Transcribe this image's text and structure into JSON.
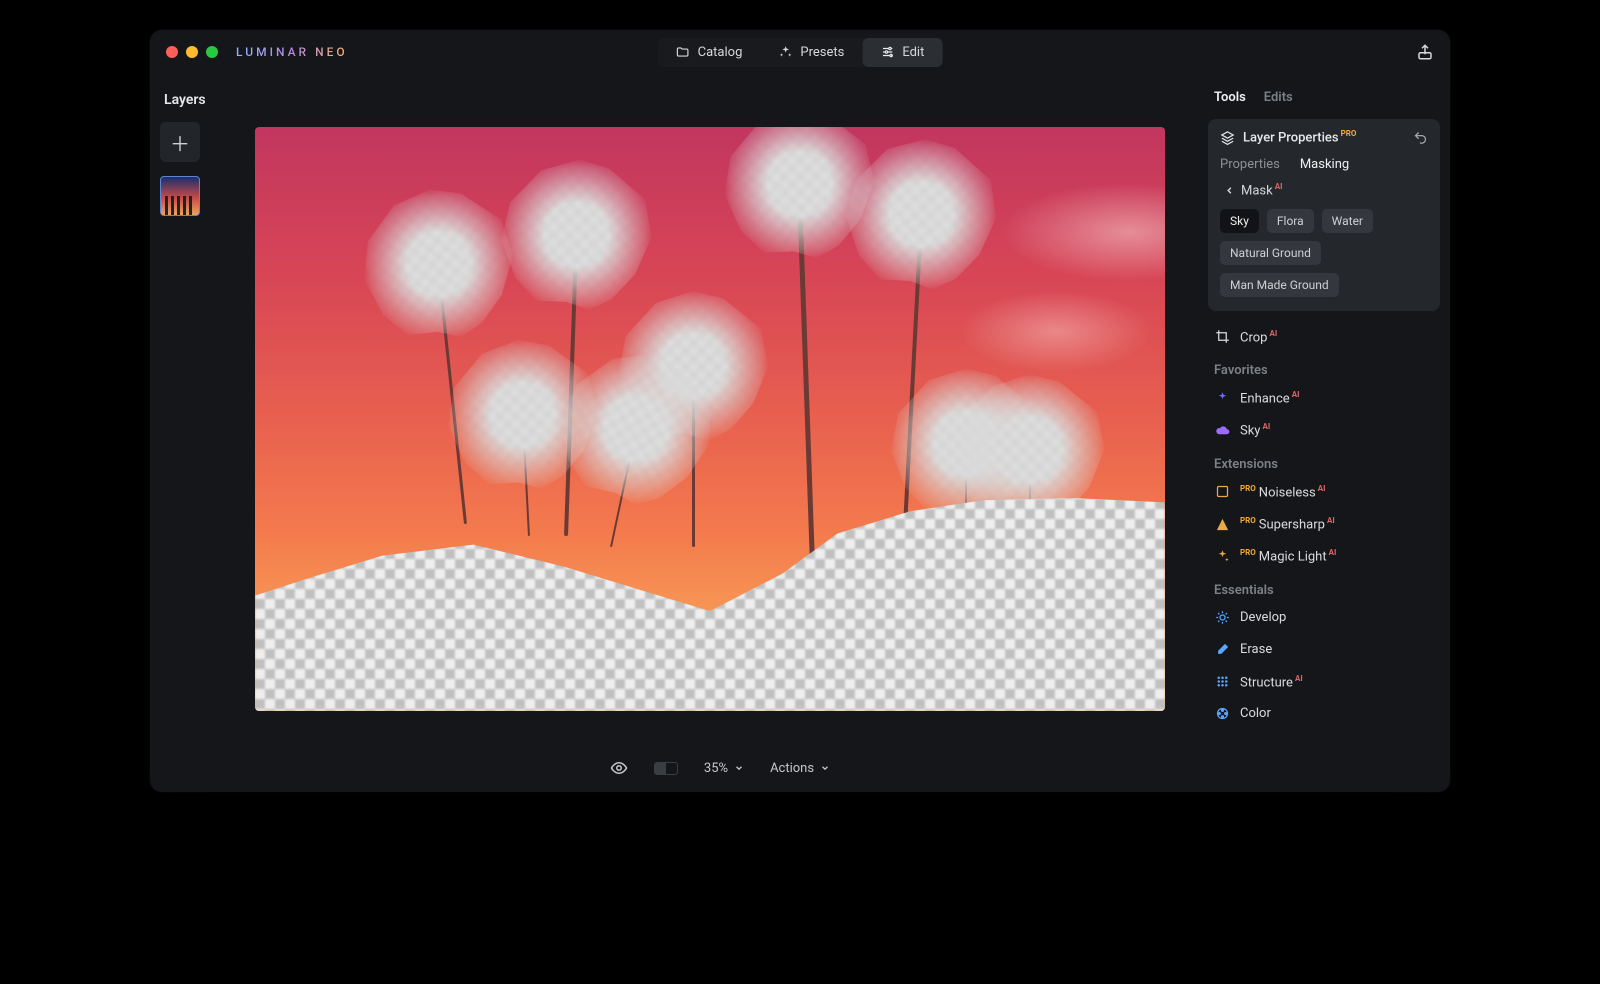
{
  "app": {
    "logo": "LUMINAR NEO"
  },
  "modes": {
    "catalog": "Catalog",
    "presets": "Presets",
    "edit": "Edit"
  },
  "layers": {
    "title": "Layers"
  },
  "toolbar": {
    "zoom": "35%",
    "actions": "Actions"
  },
  "right": {
    "tabs": {
      "tools": "Tools",
      "edits": "Edits"
    },
    "layer_properties": {
      "title": "Layer Properties",
      "subtabs": {
        "properties": "Properties",
        "masking": "Masking"
      },
      "mask_back": "Mask",
      "chips": {
        "sky": "Sky",
        "flora": "Flora",
        "water": "Water",
        "natural_ground": "Natural Ground",
        "man_made_ground": "Man Made Ground"
      }
    },
    "crop": "Crop",
    "sections": {
      "favorites": "Favorites",
      "extensions": "Extensions",
      "essentials": "Essentials"
    },
    "favorites": {
      "enhance": "Enhance",
      "sky": "Sky"
    },
    "extensions": {
      "noiseless": "Noiseless",
      "supersharp": "Supersharp",
      "magic_light": "Magic Light"
    },
    "essentials": {
      "develop": "Develop",
      "erase": "Erase",
      "structure": "Structure",
      "color": "Color"
    }
  }
}
